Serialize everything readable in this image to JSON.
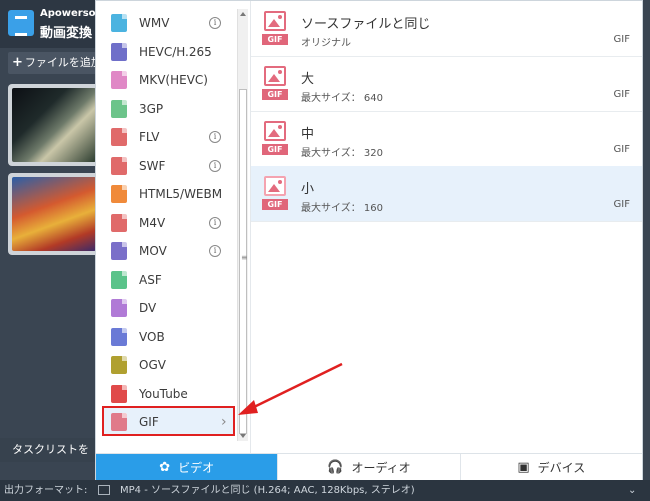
{
  "app": {
    "brand": "Apowersoft",
    "name": "動画変換",
    "add_file_label": "ファイルを追加",
    "task_list_label": "タスクリストを",
    "output_format_label": "出力フォーマット:",
    "output_format_value": "MP4 - ソースファイルと同じ (H.264; AAC, 128Kbps, ステレオ)"
  },
  "formats": [
    {
      "label": "WMV",
      "icon": "video-file-icon",
      "color": "#4bb3e0",
      "info": true
    },
    {
      "label": "HEVC/H.265",
      "icon": "video-file-icon",
      "color": "#6f6fc9",
      "info": false
    },
    {
      "label": "MKV(HEVC)",
      "icon": "video-file-icon",
      "color": "#e088c6",
      "info": false
    },
    {
      "label": "3GP",
      "icon": "video-file-icon",
      "color": "#6cc48a",
      "info": false
    },
    {
      "label": "FLV",
      "icon": "video-file-icon",
      "color": "#e06a6a",
      "info": true
    },
    {
      "label": "SWF",
      "icon": "video-file-icon",
      "color": "#e06a6a",
      "info": true
    },
    {
      "label": "HTML5/WEBM",
      "icon": "video-file-icon",
      "color": "#f08a3a",
      "info": false
    },
    {
      "label": "M4V",
      "icon": "video-file-icon",
      "color": "#e06a6a",
      "info": true
    },
    {
      "label": "MOV",
      "icon": "video-file-icon",
      "color": "#7a6fc9",
      "info": true
    },
    {
      "label": "ASF",
      "icon": "video-file-icon",
      "color": "#5ac38a",
      "info": false
    },
    {
      "label": "DV",
      "icon": "video-file-icon",
      "color": "#b07ad6",
      "info": false
    },
    {
      "label": "VOB",
      "icon": "video-file-icon",
      "color": "#6a7ad6",
      "info": false
    },
    {
      "label": "OGV",
      "icon": "video-file-icon",
      "color": "#b0a030",
      "info": false
    },
    {
      "label": "YouTube",
      "icon": "youtube-icon",
      "color": "#e04a4a",
      "info": false
    },
    {
      "label": "GIF",
      "icon": "image-file-icon",
      "color": "#e07a8a",
      "info": false,
      "selected": true
    }
  ],
  "presets": [
    {
      "title": "ソースファイルと同じ",
      "subtitle": "オリジナル",
      "format": "GIF",
      "tag": "GIF"
    },
    {
      "title": "大",
      "subtitle": "最大サイズ： 640",
      "format": "GIF",
      "tag": "GIF"
    },
    {
      "title": "中",
      "subtitle": "最大サイズ： 320",
      "format": "GIF",
      "tag": "GIF"
    },
    {
      "title": "小",
      "subtitle": "最大サイズ： 160",
      "format": "GIF",
      "tag": "GIF",
      "selected": true
    }
  ],
  "tabs": [
    {
      "label": "ビデオ",
      "icon": "film-reel-icon",
      "active": true
    },
    {
      "label": "オーディオ",
      "icon": "headphones-icon",
      "active": false
    },
    {
      "label": "デバイス",
      "icon": "devices-icon",
      "active": false
    }
  ],
  "colors": {
    "accent": "#2a9de8",
    "highlight_box": "#e02020",
    "gif_tag": "#e0667a",
    "selected_row": "#e7f1fb"
  }
}
